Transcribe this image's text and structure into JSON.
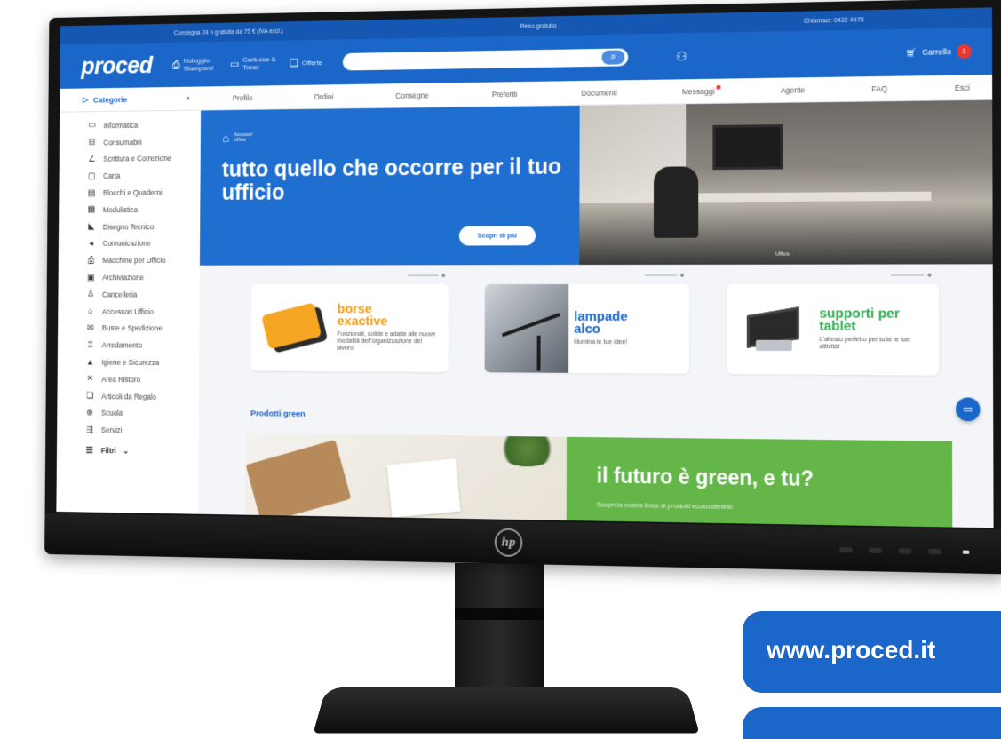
{
  "info_bar": {
    "delivery": "Consegna 24 h gratuita da 75 € (IVA excl.)",
    "returns": "Reso gratuito",
    "phone": "Chiamaci: 0422 4975"
  },
  "header": {
    "logo": "proced",
    "nav": [
      {
        "label": "Noleggio Stampanti",
        "icon": "printer-icon"
      },
      {
        "label": "Cartucce & Toner",
        "icon": "toner-icon"
      },
      {
        "label": "Offerte",
        "icon": "gift-icon"
      }
    ],
    "search_placeholder": "",
    "cart_label": "Carrello",
    "cart_count": "1"
  },
  "tabbar": {
    "categories_label": "Categorie",
    "tabs": [
      "Profilo",
      "Ordini",
      "Consegne",
      "Preferiti",
      "Documenti",
      "Messaggi",
      "Agente",
      "FAQ",
      "Esci"
    ]
  },
  "sidebar": {
    "items": [
      {
        "label": "Informatica",
        "icon": "monitor-icon"
      },
      {
        "label": "Consumabili",
        "icon": "toner-icon"
      },
      {
        "label": "Scrittura e Correzione",
        "icon": "pen-icon"
      },
      {
        "label": "Carta",
        "icon": "paper-icon"
      },
      {
        "label": "Blocchi e Quaderni",
        "icon": "notebook-icon"
      },
      {
        "label": "Modulistica",
        "icon": "form-icon"
      },
      {
        "label": "Disegno Tecnico",
        "icon": "ruler-icon"
      },
      {
        "label": "Comunicazione",
        "icon": "megaphone-icon"
      },
      {
        "label": "Macchine per Ufficio",
        "icon": "printer-icon"
      },
      {
        "label": "Archiviazione",
        "icon": "archive-icon"
      },
      {
        "label": "Cancelleria",
        "icon": "stapler-icon"
      },
      {
        "label": "Accessori Ufficio",
        "icon": "briefcase-icon"
      },
      {
        "label": "Buste e Spedizione",
        "icon": "envelope-icon"
      },
      {
        "label": "Arredamento",
        "icon": "chair-icon"
      },
      {
        "label": "Igiene e Sicurezza",
        "icon": "soap-icon"
      },
      {
        "label": "Area Ristoro",
        "icon": "cutlery-icon"
      },
      {
        "label": "Articoli da Regalo",
        "icon": "gift-icon"
      },
      {
        "label": "Scuola",
        "icon": "school-icon"
      },
      {
        "label": "Servizi",
        "icon": "services-icon"
      }
    ],
    "filters_label": "Filtri"
  },
  "hero": {
    "tag": "Accessori Ufficio",
    "title": "tutto quello che occorre per il tuo ufficio",
    "button": "Scopri di più",
    "image_caption": "Ufficio"
  },
  "promos": [
    {
      "title": "borse exactive",
      "desc": "Funzionali, solide e adatte alle nuove modalità dell'organizzazione del lavoro"
    },
    {
      "title": "lampade alco",
      "desc": "Illumina le tue idee!"
    },
    {
      "title": "supporti per tablet",
      "desc": "L'alleato perfetto per tutte le tue attività!"
    }
  ],
  "green": {
    "section_label": "Prodotti green",
    "title": "il futuro è green, e tu?",
    "subtitle": "Scopri la nostra linea di prodotti ecosostenibili"
  },
  "badge": {
    "url": "www.proced.it"
  },
  "colors": {
    "brand_blue": "#1b66c9",
    "accent_orange": "#f39c12",
    "accent_green": "#64b649",
    "alert_red": "#e53935"
  }
}
